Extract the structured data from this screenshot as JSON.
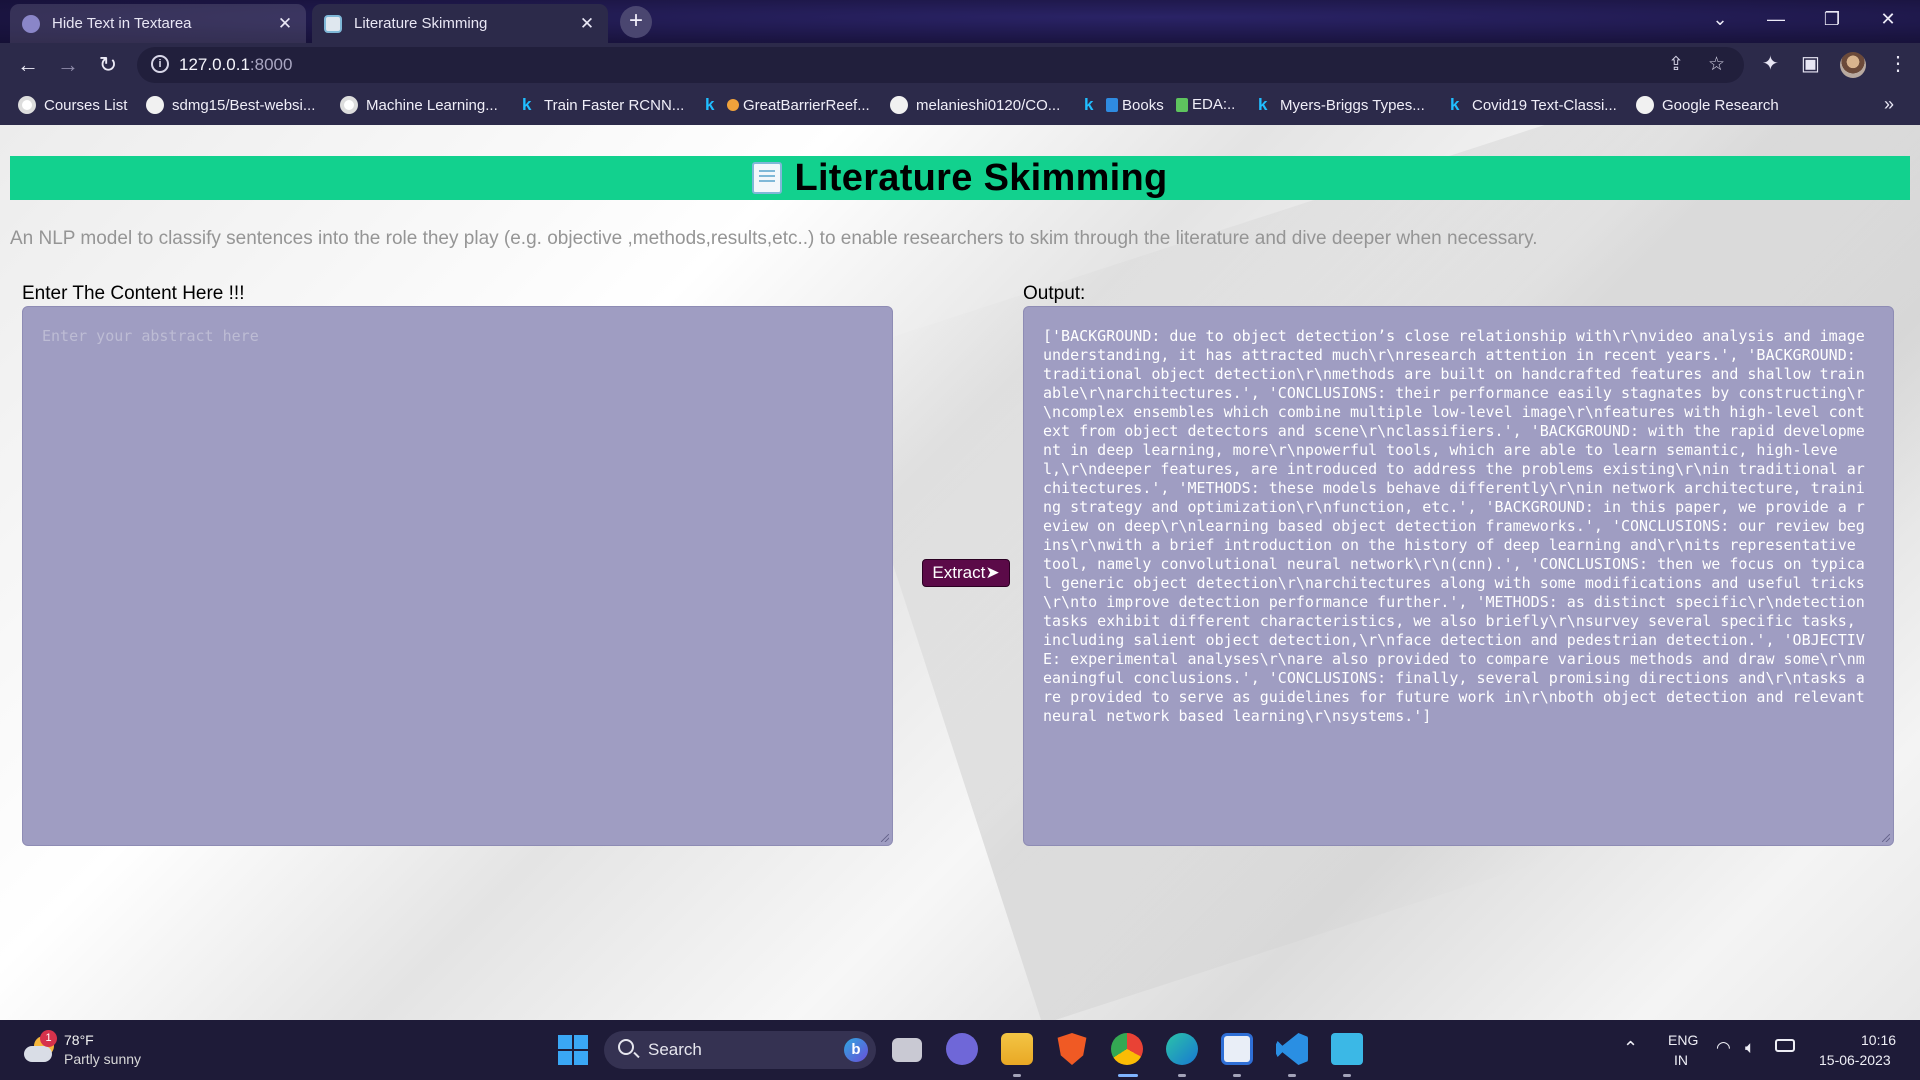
{
  "browser": {
    "tabs": [
      {
        "title": "Hide Text in Textarea",
        "active": false
      },
      {
        "title": "Literature Skimming",
        "active": true
      }
    ],
    "new_tab_label": "+",
    "url_host": "127.0.0.1",
    "url_port": ":8000",
    "bookmarks": [
      {
        "label": "Courses List",
        "icon": "google-icon"
      },
      {
        "label": "sdmg15/Best-websi...",
        "icon": "github-icon"
      },
      {
        "label": "Machine Learning...",
        "icon": "google-icon"
      },
      {
        "label": "Train Faster RCNN...",
        "icon": "kaggle-icon"
      },
      {
        "label": "GreatBarrierReef...",
        "icon": "kaggle-icon"
      },
      {
        "label": "melanieshi0120/CO...",
        "icon": "github-icon"
      },
      {
        "label": "Books",
        "icon": "kaggle-icon"
      },
      {
        "label": "EDA:..",
        "icon": "folder-icon"
      },
      {
        "label": "Myers-Briggs Types...",
        "icon": "kaggle-icon"
      },
      {
        "label": "Covid19 Text-Classi...",
        "icon": "kaggle-icon"
      },
      {
        "label": "Google Research",
        "icon": "github-icon"
      }
    ]
  },
  "page": {
    "title": "Literature Skimming",
    "subtitle": "An NLP model to classify sentences into the role they play (e.g. objective ,methods,results,etc..) to enable researchers to skim through the literature and dive deeper when necessary.",
    "input_label": "Enter The Content Here !!!",
    "input_placeholder": "Enter your abstract here",
    "output_label": "Output:",
    "extract_button": "Extract➤",
    "output_text": "['BACKGROUND: due to object detection’s close relationship with\\r\\nvideo analysis and image understanding, it has attracted much\\r\\nresearch attention in recent years.', 'BACKGROUND: traditional object detection\\r\\nmethods are built on handcrafted features and shallow trainable\\r\\narchitectures.', 'CONCLUSIONS: their performance easily stagnates by constructing\\r\\ncomplex ensembles which combine multiple low-level image\\r\\nfeatures with high-level context from object detectors and scene\\r\\nclassifiers.', 'BACKGROUND: with the rapid development in deep learning, more\\r\\npowerful tools, which are able to learn semantic, high-level,\\r\\ndeeper features, are introduced to address the problems existing\\r\\nin traditional architectures.', 'METHODS: these models behave differently\\r\\nin network architecture, training strategy and optimization\\r\\nfunction, etc.', 'BACKGROUND: in this paper, we provide a review on deep\\r\\nlearning based object detection frameworks.', 'CONCLUSIONS: our review begins\\r\\nwith a brief introduction on the history of deep learning and\\r\\nits representative tool, namely convolutional neural network\\r\\n(cnn).', 'CONCLUSIONS: then we focus on typical generic object detection\\r\\narchitectures along with some modifications and useful tricks\\r\\nto improve detection performance further.', 'METHODS: as distinct specific\\r\\ndetection tasks exhibit different characteristics, we also briefly\\r\\nsurvey several specific tasks, including salient object detection,\\r\\nface detection and pedestrian detection.', 'OBJECTIVE: experimental analyses\\r\\nare also provided to compare various methods and draw some\\r\\nmeaningful conclusions.', 'CONCLUSIONS: finally, several promising directions and\\r\\ntasks are provided to serve as guidelines for future work in\\r\\nboth object detection and relevant neural network based learning\\r\\nsystems.']"
  },
  "taskbar": {
    "weather_temp": "78°F",
    "weather_condition": "Partly sunny",
    "weather_badge": "1",
    "search_label": "Search",
    "language_line1": "ENG",
    "language_line2": "IN",
    "time": "10:16",
    "date": "15-06-2023"
  },
  "colors": {
    "header_green": "#12d18e",
    "textarea_bg": "#9f9dc2",
    "button_bg": "#5b0a48",
    "browser_frame": "#2c2a4a"
  }
}
